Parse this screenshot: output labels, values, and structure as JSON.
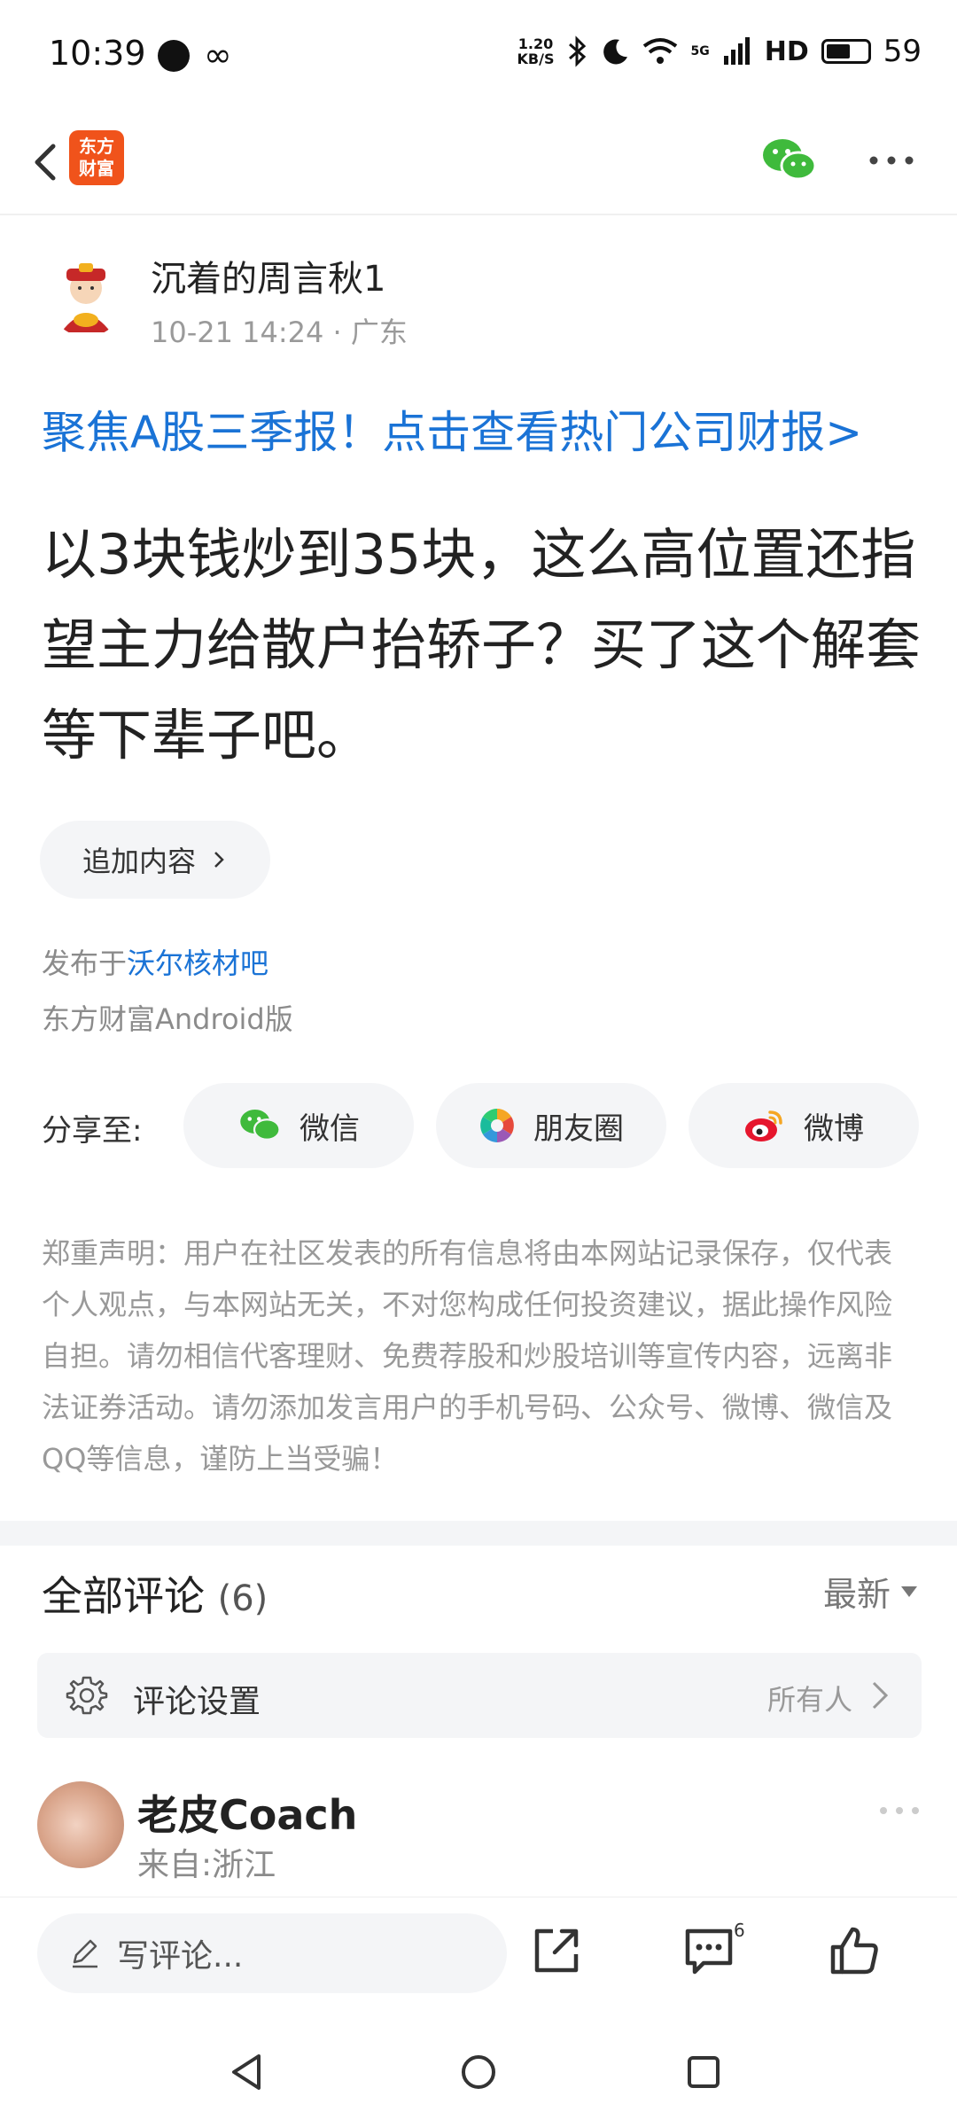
{
  "status_bar": {
    "time": "10:39",
    "speed_top": "1.20",
    "speed_bottom": "KB/S",
    "network": "5G",
    "hd": "HD",
    "battery": "59",
    "battery_level": 0.59
  },
  "nav": {
    "logo_line1": "东方",
    "logo_line2": "财富",
    "icons": [
      "back-icon",
      "wechat-icon",
      "more-icon"
    ]
  },
  "author": {
    "name": "沉着的周言秋1",
    "time": "10-21 14:24",
    "location": "· 广东"
  },
  "promo": "聚焦A股三季报！点击查看热门公司财报>",
  "title": "以3块钱炒到35块，这么高位置还指望主力给散户抬轿子？买了这个解套等下辈子吧。",
  "append_button": "追加内容",
  "publish": {
    "prefix": "发布于",
    "forum": "沃尔核材吧",
    "client": "东方财富Android版"
  },
  "share": {
    "label": "分享至:",
    "wechat": "微信",
    "moments": "朋友圈",
    "weibo": "微博"
  },
  "disclaimer": "郑重声明：用户在社区发表的所有信息将由本网站记录保存，仅代表个人观点，与本网站无关，不对您构成任何投资建议，据此操作风险自担。请勿相信代客理财、免费荐股和炒股培训等宣传内容，远离非法证券活动。请勿添加发言用户的手机号码、公众号、微博、微信及QQ等信息，谨防上当受骗！",
  "comments": {
    "title": "全部评论",
    "count": "(6)",
    "sort": "最新",
    "settings_label": "评论设置",
    "settings_value": "所有人",
    "first": {
      "name": "老皮Coach",
      "location": "来自:浙江"
    }
  },
  "bottom_bar": {
    "write_placeholder": "写评论...",
    "comment_badge": "6"
  },
  "colors": {
    "link_blue": "#1a73d6",
    "brand_orange": "#f0531b",
    "wechat_green": "#3fba3c",
    "weibo_red": "#e6162d"
  }
}
